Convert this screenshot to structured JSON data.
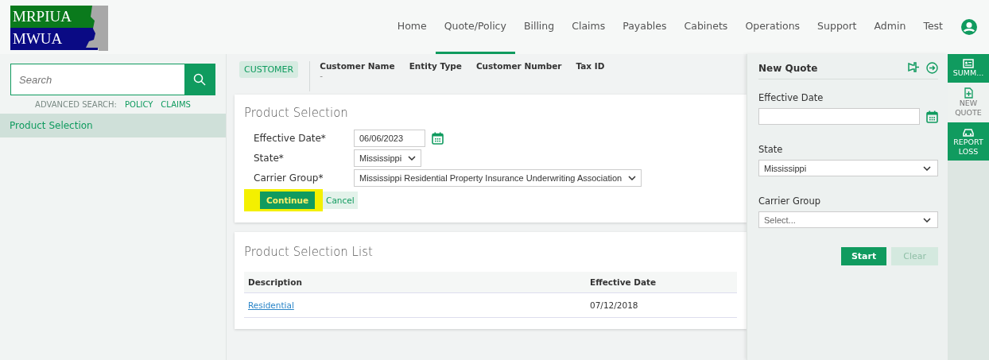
{
  "logo": {
    "line_1": "MRPIUA",
    "line_2": "MWUA"
  },
  "nav": [
    {
      "label": "Home",
      "selected": false
    },
    {
      "label": "Quote/Policy",
      "selected": true
    },
    {
      "label": "Billing",
      "selected": false
    },
    {
      "label": "Claims",
      "selected": false
    },
    {
      "label": "Payables",
      "selected": false
    },
    {
      "label": "Cabinets",
      "selected": false
    },
    {
      "label": "Operations",
      "selected": false
    },
    {
      "label": "Support",
      "selected": false
    },
    {
      "label": "Admin",
      "selected": false
    },
    {
      "label": "Test",
      "selected": false
    }
  ],
  "sidebar": {
    "search": {
      "placeholder": "Search"
    },
    "advanced_label": "ADVANCED SEARCH:",
    "advanced_links": [
      "POLICY",
      "CLAIMS"
    ],
    "items": [
      {
        "label": "Product Selection",
        "selected": true
      }
    ]
  },
  "customer_bar": {
    "badge": "CUSTOMER",
    "fields": [
      {
        "label": "Customer Name",
        "value": "-"
      },
      {
        "label": "Entity Type"
      },
      {
        "label": "Customer Number"
      },
      {
        "label": "Tax ID"
      }
    ]
  },
  "product_selection": {
    "title": "Product Selection",
    "effective_date_label": "Effective Date*",
    "effective_date": "06/06/2023",
    "state_label": "State*",
    "state": "Mississippi",
    "carrier_label": "Carrier Group*",
    "carrier": "Mississippi Residential Property Insurance Underwriting Association",
    "continue": "Continue",
    "cancel": "Cancel"
  },
  "product_list": {
    "title": "Product Selection List",
    "columns": [
      "Description",
      "Effective Date"
    ],
    "rows": [
      {
        "description": "Residential",
        "effective_date": "07/12/2018"
      }
    ]
  },
  "new_quote": {
    "title": "New Quote",
    "effective_date_label": "Effective Date",
    "state_label": "State",
    "state": "Mississippi",
    "carrier_label": "Carrier Group",
    "carrier_placeholder": "Select...",
    "start": "Start",
    "clear": "Clear"
  },
  "rail": [
    {
      "kind": "filled",
      "label": "SUMM..."
    },
    {
      "kind": "plain",
      "label": "NEW QUOTE"
    },
    {
      "kind": "filled",
      "label": "REPORT LOSS"
    }
  ]
}
